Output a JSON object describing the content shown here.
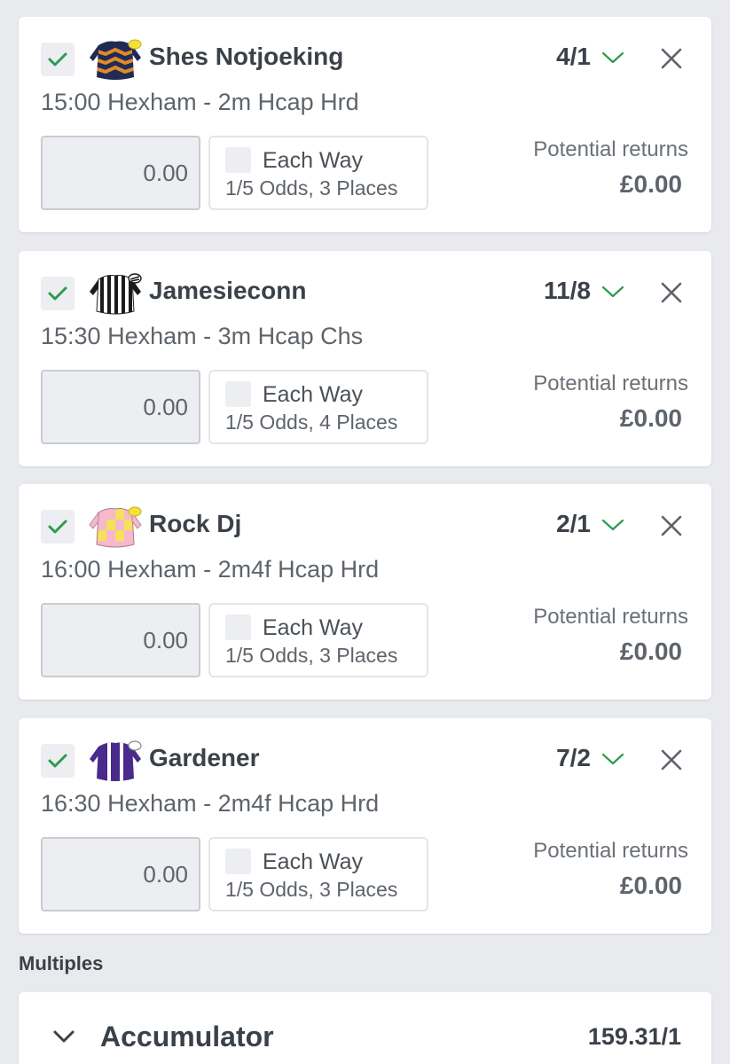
{
  "colors": {
    "accent_green": "#2e9b4f",
    "card_bg": "#ffffff",
    "page_bg": "#e9eaee"
  },
  "selections": [
    {
      "name": "Shes Notjoeking",
      "odds": "4/1",
      "race": "15:00 Hexham - 2m Hcap Hrd",
      "stake": "0.00",
      "each_way_label": "Each Way",
      "each_way_terms": "1/5 Odds, 3 Places",
      "returns_label": "Potential returns",
      "returns_value": "£0.00",
      "silk": "navy-orange-chevrons-silk-icon"
    },
    {
      "name": "Jamesieconn",
      "odds": "11/8",
      "race": "15:30 Hexham - 3m Hcap Chs",
      "stake": "0.00",
      "each_way_label": "Each Way",
      "each_way_terms": "1/5 Odds, 4 Places",
      "returns_label": "Potential returns",
      "returns_value": "£0.00",
      "silk": "black-white-stripes-silk-icon"
    },
    {
      "name": "Rock Dj",
      "odds": "2/1",
      "race": "16:00 Hexham - 2m4f Hcap Hrd",
      "stake": "0.00",
      "each_way_label": "Each Way",
      "each_way_terms": "1/5 Odds, 3 Places",
      "returns_label": "Potential returns",
      "returns_value": "£0.00",
      "silk": "pink-yellow-check-silk-icon"
    },
    {
      "name": "Gardener",
      "odds": "7/2",
      "race": "16:30 Hexham - 2m4f Hcap Hrd",
      "stake": "0.00",
      "each_way_label": "Each Way",
      "each_way_terms": "1/5 Odds, 3 Places",
      "returns_label": "Potential returns",
      "returns_value": "£0.00",
      "silk": "purple-white-stripes-silk-icon"
    }
  ],
  "multiples": {
    "heading": "Multiples",
    "accumulator": {
      "label": "Accumulator",
      "odds": "159.31/1"
    }
  }
}
